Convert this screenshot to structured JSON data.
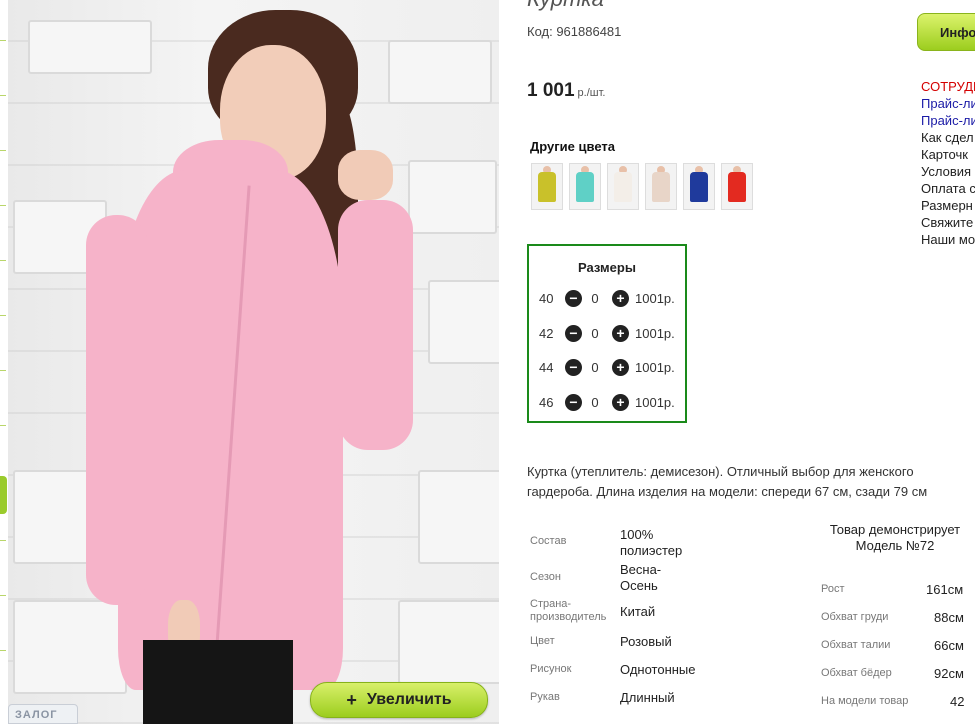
{
  "product": {
    "title": "Куртка",
    "code": "Код: 961886481",
    "price": "1 001",
    "price_unit": "р./шт.",
    "other_colors_title": "Другие цвета",
    "colors": [
      "#c9c12a",
      "#5fd0c6",
      "#f3eee8",
      "#e8d5c8",
      "#1f3a9c",
      "#e32a20"
    ]
  },
  "zoom_button_label": "Увеличить",
  "catalog_tag": "ЗАЛОГ",
  "sizes": {
    "title": "Размеры",
    "rows": [
      {
        "size": "40",
        "qty": "0",
        "price": "1001р."
      },
      {
        "size": "42",
        "qty": "0",
        "price": "1001р."
      },
      {
        "size": "44",
        "qty": "0",
        "price": "1001р."
      },
      {
        "size": "46",
        "qty": "0",
        "price": "1001р."
      }
    ]
  },
  "description": "Куртка (утеплитель: демисезон). Отличный выбор для женского гардероба. Длина изделия на модели: спереди 67 см, сзади 79 см",
  "specs": [
    {
      "label": "Состав",
      "value": "100% полиэстер"
    },
    {
      "label": "Сезон",
      "value": "Весна-Осень"
    },
    {
      "label": "Страна-производитель",
      "value": "Китай"
    },
    {
      "label": "Цвет",
      "value": "Розовый"
    },
    {
      "label": "Рисунок",
      "value": "Однотонные"
    },
    {
      "label": "Рукав",
      "value": "Длинный"
    }
  ],
  "model": {
    "header": "Товар демонстрирует Модель №72",
    "rows": [
      {
        "label": "Рост",
        "value": "161см"
      },
      {
        "label": "Обхват груди",
        "value": "88см"
      },
      {
        "label": "Обхват талии",
        "value": "66см"
      },
      {
        "label": "Обхват бёдер",
        "value": "92см"
      },
      {
        "label": "На модели товар",
        "value": "42"
      }
    ]
  },
  "right_panel": {
    "info_button": "Инфо",
    "links": [
      {
        "text": "СОТРУДН",
        "color": "#d40000"
      },
      {
        "text": "Прайс-ли",
        "color": "#1a1aa6"
      },
      {
        "text": "Прайс-ли",
        "color": "#1a1aa6"
      },
      {
        "text": "Как сдел",
        "color": "#222222"
      },
      {
        "text": "Карточк",
        "color": "#222222"
      },
      {
        "text": "Условия",
        "color": "#222222"
      },
      {
        "text": "Оплата с",
        "color": "#222222"
      },
      {
        "text": "Размерн",
        "color": "#222222"
      },
      {
        "text": "Свяжите",
        "color": "#222222"
      },
      {
        "text": "Наши мо",
        "color": "#222222"
      }
    ]
  }
}
